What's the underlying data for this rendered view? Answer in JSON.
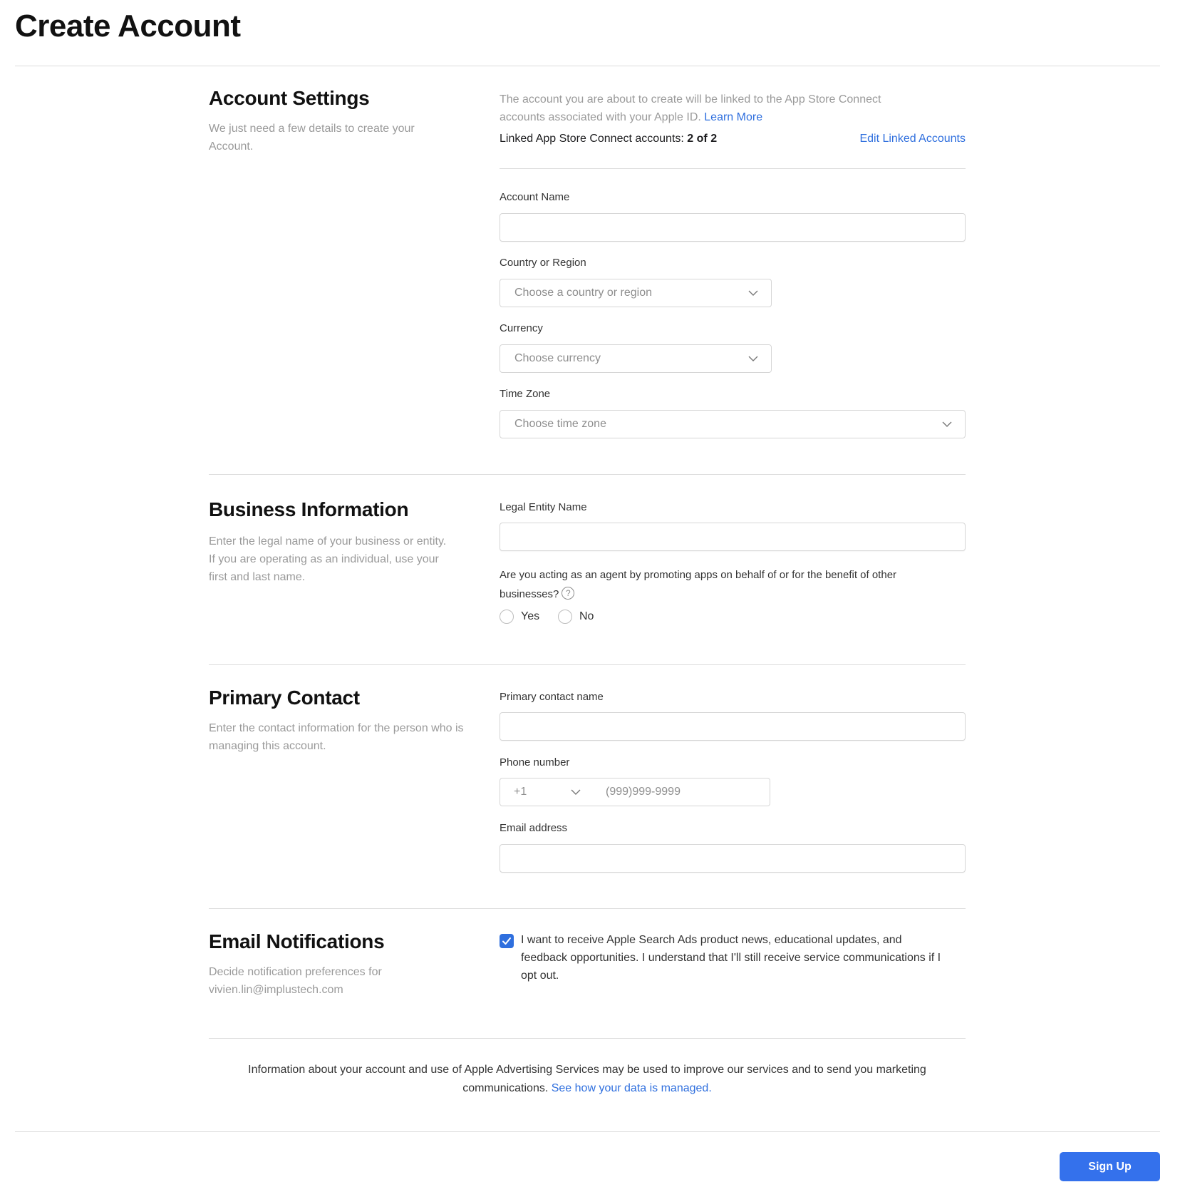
{
  "page": {
    "title": "Create Account"
  },
  "account_settings": {
    "title": "Account Settings",
    "description": "We just need a few details to create your Account.",
    "info_text": "The account you are about to create will be linked to the App Store Connect accounts associated with your Apple ID.",
    "learn_more": "Learn More",
    "linked_label": "Linked App Store Connect accounts:",
    "linked_value": "2 of 2",
    "edit_linked": "Edit Linked Accounts",
    "account_name_label": "Account Name",
    "account_name_value": "",
    "country_label": "Country or Region",
    "country_placeholder": "Choose a country or region",
    "currency_label": "Currency",
    "currency_placeholder": "Choose currency",
    "timezone_label": "Time Zone",
    "timezone_placeholder": "Choose time zone"
  },
  "business_information": {
    "title": "Business Information",
    "description": "Enter the legal name of your business or entity. If you are operating as an individual, use your first and last name.",
    "legal_entity_label": "Legal Entity Name",
    "legal_entity_value": "",
    "agent_question": "Are you acting as an agent by promoting apps on behalf of or for the benefit of other businesses?",
    "help_icon": "question-circle-icon",
    "options": [
      "Yes",
      "No"
    ],
    "selected": null
  },
  "primary_contact": {
    "title": "Primary Contact",
    "description": "Enter the contact information for the person who is managing this account.",
    "name_label": "Primary contact name",
    "name_value": "",
    "phone_label": "Phone number",
    "country_code": "+1",
    "phone_placeholder": "(999)999-9999",
    "email_label": "Email address",
    "email_value": ""
  },
  "email_notifications": {
    "title": "Email Notifications",
    "description": "Decide notification preferences for",
    "email": "vivien.lin@implustech.com",
    "checkbox_checked": true,
    "checkbox_text": "I want to receive Apple Search Ads product news, educational updates, and feedback opportunities. I understand that I'll still receive service communications if I opt out."
  },
  "footer": {
    "text": "Information about your account and use of Apple Advertising Services may be used to improve our services and to send you marketing communications.",
    "link": "See how your data is managed.",
    "sign_up": "Sign Up"
  },
  "colors": {
    "accent": "#3471ec",
    "link": "#2f6fde",
    "muted": "#9a9a9a"
  }
}
